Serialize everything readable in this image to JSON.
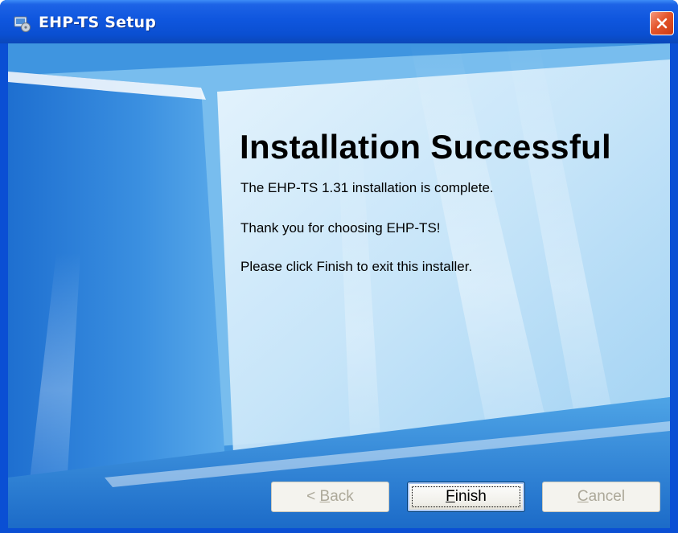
{
  "window": {
    "title": "EHP-TS Setup",
    "title_icon": "installer-app-icon",
    "close_icon": "close-x-icon",
    "titlebar_color": "#0a4fd1",
    "close_color": "#e4552b"
  },
  "content": {
    "heading": "Installation Successful",
    "lines": [
      "The EHP-TS 1.31 installation is complete.",
      "Thank you for choosing EHP-TS!",
      "Please click Finish to exit this installer."
    ]
  },
  "buttons": {
    "back": {
      "prefix": "< ",
      "mnemonic": "B",
      "rest": "ack",
      "enabled": false
    },
    "finish": {
      "prefix": "",
      "mnemonic": "F",
      "rest": "inish",
      "enabled": true,
      "focused": true
    },
    "cancel": {
      "prefix": "",
      "mnemonic": "C",
      "rest": "ancel",
      "enabled": false
    }
  }
}
